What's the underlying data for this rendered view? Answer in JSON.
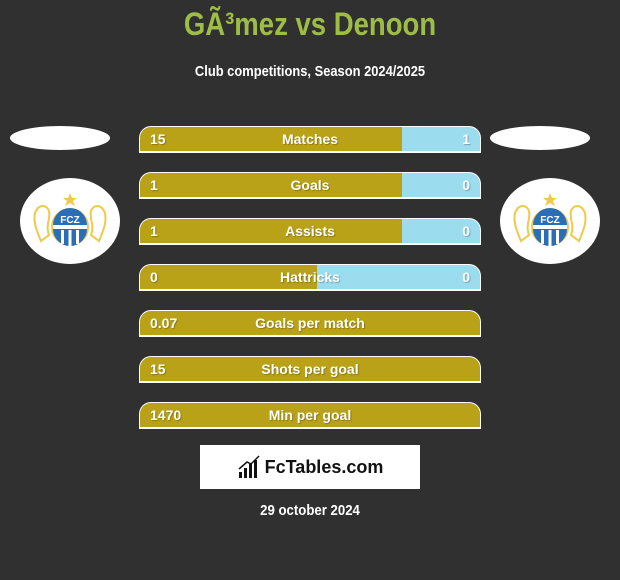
{
  "header": {
    "title": "GÃ³mez vs Denoon",
    "subtitle": "Club competitions, Season 2024/2025"
  },
  "teams": {
    "left": {
      "logo_icon": "fc-zurich-crest-icon",
      "logo_text": "FCZ"
    },
    "right": {
      "logo_icon": "fc-zurich-crest-icon",
      "logo_text": "FCZ"
    }
  },
  "colors": {
    "left_bar": "#b9a218",
    "right_bar": "#9bdcef",
    "title": "#9dbd45",
    "background": "#303030"
  },
  "stats": [
    {
      "label": "Matches",
      "left": "15",
      "right": "1",
      "left_share": 0.77
    },
    {
      "label": "Goals",
      "left": "1",
      "right": "0",
      "left_share": 0.77
    },
    {
      "label": "Assists",
      "left": "1",
      "right": "0",
      "left_share": 0.77
    },
    {
      "label": "Hattricks",
      "left": "0",
      "right": "0",
      "left_share": 0.52
    },
    {
      "label": "Goals per match",
      "left": "0.07",
      "right": "",
      "left_share": 1.0
    },
    {
      "label": "Shots per goal",
      "left": "15",
      "right": "",
      "left_share": 1.0
    },
    {
      "label": "Min per goal",
      "left": "1470",
      "right": "",
      "left_share": 1.0
    }
  ],
  "footer": {
    "brand": "FcTables.com",
    "brand_icon": "bar-chart-icon",
    "date": "29 october 2024"
  }
}
